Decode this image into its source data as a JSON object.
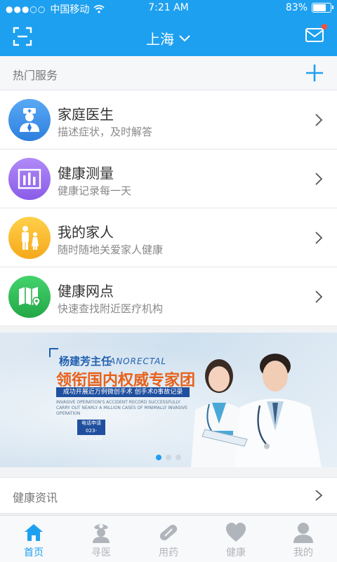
{
  "status_bar": {
    "carrier": "中国移动",
    "time": "7:21 AM",
    "battery": "83%",
    "battery_level": 0.83
  },
  "header": {
    "city": "上海",
    "icons": [
      "scan-icon",
      "chevron-down-icon",
      "mail-icon"
    ]
  },
  "hot_services": {
    "title": "热门服务",
    "add_icon": "plus-icon"
  },
  "services": [
    {
      "name": "家庭医生",
      "desc": "描述症状，及时解答",
      "icon": "doctor-icon",
      "color": "#3d8fe8"
    },
    {
      "name": "健康测量",
      "desc": "健康记录每一天",
      "icon": "chart-icon",
      "color": "#9b6ff0"
    },
    {
      "name": "我的家人",
      "desc": "随时随地关爱家人健康",
      "icon": "family-icon",
      "color": "#f5b82a"
    },
    {
      "name": "健康网点",
      "desc": "快速查找附近医疗机构",
      "icon": "map-icon",
      "color": "#2fbf57"
    }
  ],
  "banner": {
    "doctor_name": "杨建芳主任",
    "english_title": "ANORECTAL",
    "headline": "领衔国内权威专家团",
    "stripe_text": "成功开展近万例微创手术 创手术0事故记录",
    "small_text": "INVASIVE OPERATION'S ACCIDENT RECORD SUCCESSFULLY CARRY OUT NEARLY A MILLION CASES OF MINIMALLY INVASIVE OPERATION",
    "phone_label": "电话申请",
    "phone_number": "023-6878166",
    "pager_count": 3,
    "pager_active": 0
  },
  "news": {
    "title": "健康资讯"
  },
  "tabbar": [
    {
      "label": "首页",
      "icon": "home-icon",
      "active": true
    },
    {
      "label": "寻医",
      "icon": "nurse-icon",
      "active": false
    },
    {
      "label": "用药",
      "icon": "pill-icon",
      "active": false
    },
    {
      "label": "健康",
      "icon": "heart-icon",
      "active": false
    },
    {
      "label": "我的",
      "icon": "user-icon",
      "active": false
    }
  ],
  "colors": {
    "accent": "#1ea0f0",
    "tab_inactive": "#b0b5bb",
    "banner_orange": "#e8611a",
    "badge_red": "#ff4b3e"
  }
}
